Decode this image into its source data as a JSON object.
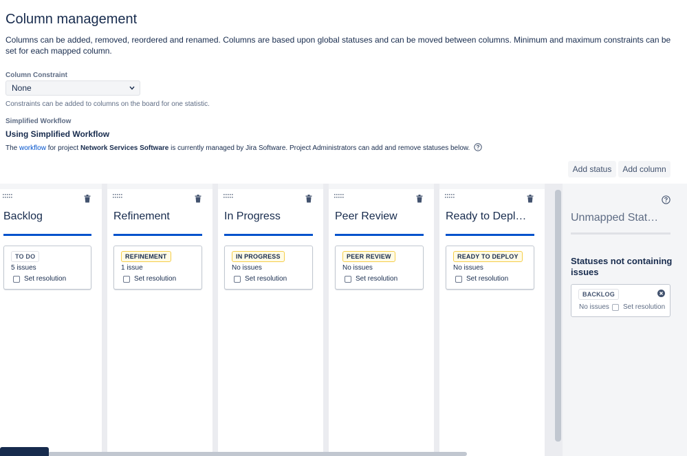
{
  "header": {
    "title": "Column management",
    "description": "Columns can be added, removed, reordered and renamed. Columns are based upon global statuses and can be moved between columns. Minimum and maximum constraints can be set for each mapped column."
  },
  "constraint": {
    "label": "Column Constraint",
    "selected": "None",
    "hint": "Constraints can be added to columns on the board for one statistic."
  },
  "workflow": {
    "label": "Simplified Workflow",
    "title": "Using Simplified Workflow",
    "desc_prefix": "The ",
    "link_text": "workflow",
    "desc_middle": " for project ",
    "project_name": "Network Services Software",
    "desc_suffix": " is currently managed by Jira Software. Project Administrators can add and remove statuses below."
  },
  "actions": {
    "add_status": "Add status",
    "add_column": "Add column"
  },
  "columns": [
    {
      "title": "Backlog",
      "status": "TO DO",
      "issues": "5 issues",
      "resolution": "Set resolution"
    },
    {
      "title": "Refinement",
      "status": "REFINEMENT",
      "issues": "1 issue",
      "resolution": "Set resolution"
    },
    {
      "title": "In Progress",
      "status": "IN PROGRESS",
      "issues": "No issues",
      "resolution": "Set resolution"
    },
    {
      "title": "Peer Review",
      "status": "PEER REVIEW",
      "issues": "No issues",
      "resolution": "Set resolution"
    },
    {
      "title": "Ready to Depl…",
      "status": "READY TO DEPLOY",
      "issues": "No issues",
      "resolution": "Set resolution"
    }
  ],
  "unmapped": {
    "title": "Unmapped Stat…",
    "subtitle": "Statuses not containing issues",
    "status": "BACKLOG",
    "issues": "No issues",
    "resolution": "Set resolution"
  },
  "colors": {
    "accent": "#0052cc",
    "text": "#172b4d",
    "subtle": "#5e6c84",
    "lozenge_yellow_border": "#f5cd47"
  },
  "icons": [
    "drag-handle-icon",
    "trash-icon",
    "help-icon",
    "close-icon",
    "chevron-down-icon"
  ]
}
